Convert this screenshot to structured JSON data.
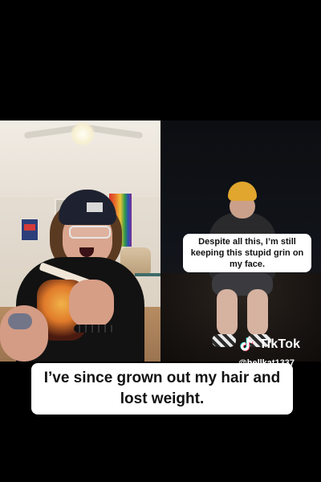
{
  "overlays": {
    "caption_small": "Despite all this, I’m still keeping this stupid grin on my face.",
    "caption_main": "I’ve since grown out my hair and lost weight.",
    "brand": "TikTok",
    "handle": "@hellkat1337"
  },
  "icons": {
    "tiktok_logo": "tiktok-logo-icon"
  },
  "colors": {
    "background": "#000000",
    "caption_bg": "#ffffff",
    "caption_text": "#111111",
    "accent_cyan": "#25F4EE",
    "accent_red": "#FE2C55"
  }
}
